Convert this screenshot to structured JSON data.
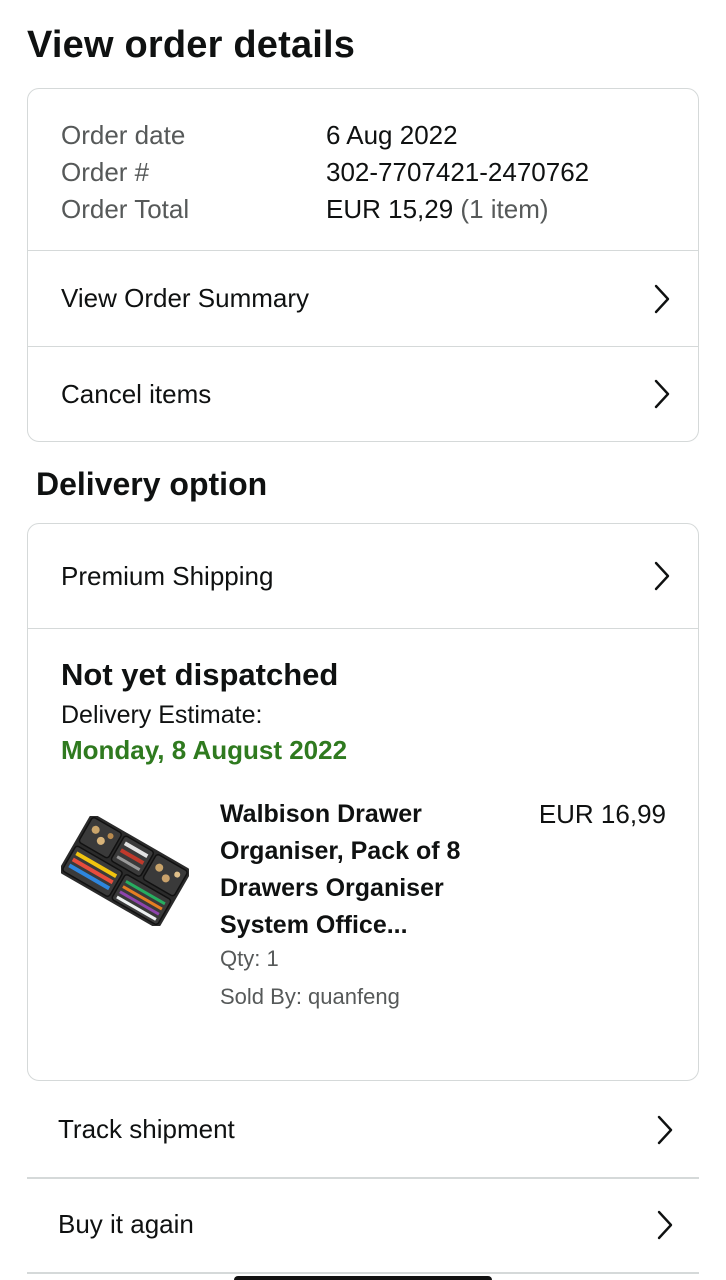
{
  "page_title": "View order details",
  "order": {
    "date_label": "Order date",
    "date_value": "6 Aug 2022",
    "number_label": "Order #",
    "number_value": "302-7707421-2470762",
    "total_label": "Order Total",
    "total_value": "EUR 15,29",
    "total_items": "(1 item)"
  },
  "order_actions": {
    "summary_label": "View Order Summary",
    "cancel_label": "Cancel items"
  },
  "delivery": {
    "section_title": "Delivery option",
    "shipping_label": "Premium Shipping",
    "status": "Not yet dispatched",
    "estimate_label": "Delivery Estimate:",
    "estimate_date": "Monday, 8 August 2022",
    "estimate_color": "#2f7a1f"
  },
  "item": {
    "title": "Walbison Drawer Organiser, Pack of 8 Drawers Organiser System Office...",
    "price": "EUR 16,99",
    "qty": "Qty: 1",
    "sold_by": "Sold By: quanfeng"
  },
  "actions": {
    "track_label": "Track shipment",
    "buy_again_label": "Buy it again"
  },
  "icons": {
    "chevron": "chevron-right-icon"
  }
}
